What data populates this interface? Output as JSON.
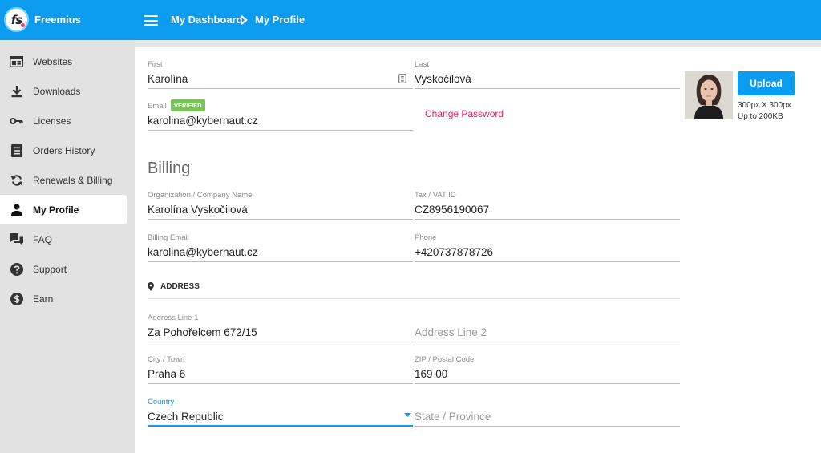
{
  "app": {
    "brand": "Freemius",
    "logo_text": "fs"
  },
  "breadcrumb": [
    "My Dashboard",
    "My Profile"
  ],
  "sidebar": {
    "items": [
      {
        "label": "Websites",
        "icon": "browser-window-icon"
      },
      {
        "label": "Downloads",
        "icon": "download-icon"
      },
      {
        "label": "Licenses",
        "icon": "key-icon"
      },
      {
        "label": "Orders History",
        "icon": "list-document-icon"
      },
      {
        "label": "Renewals & Billing",
        "icon": "sync-icon"
      },
      {
        "label": "My Profile",
        "icon": "person-icon",
        "active": true
      },
      {
        "label": "FAQ",
        "icon": "chat-bubbles-icon"
      },
      {
        "label": "Support",
        "icon": "question-circle-icon"
      },
      {
        "label": "Earn",
        "icon": "dollar-circle-icon"
      }
    ]
  },
  "profile": {
    "first": {
      "label": "First",
      "value": "Karolína"
    },
    "last": {
      "label": "Last",
      "value": "Vyskočilová"
    },
    "email": {
      "label": "Email",
      "badge": "VERIFIED",
      "value": "karolina@kybernaut.cz"
    },
    "change_password": "Change Password",
    "upload_label": "Upload",
    "upload_dims": "300px X 300px",
    "upload_size": "Up to 200KB"
  },
  "billing": {
    "heading": "Billing",
    "company": {
      "label": "Organization / Company Name",
      "value": "Karolína Vyskočilová"
    },
    "tax": {
      "label": "Tax / VAT ID",
      "value": "CZ8956190067"
    },
    "billing_email": {
      "label": "Billing Email",
      "value": "karolina@kybernaut.cz"
    },
    "phone": {
      "label": "Phone",
      "value": "+420737878726"
    }
  },
  "address": {
    "heading": "ADDRESS",
    "line1": {
      "label": "Address Line 1",
      "value": "Za Pohořelcem 672/15"
    },
    "line2": {
      "placeholder": "Address Line 2"
    },
    "city": {
      "label": "City / Town",
      "value": "Praha 6"
    },
    "zip": {
      "label": "ZIP / Postal Code",
      "value": "169 00"
    },
    "country": {
      "label": "Country",
      "value": "Czech Republic"
    },
    "state": {
      "placeholder": "State / Province"
    }
  },
  "colors": {
    "primary": "#0b9cf0",
    "accent": "#e91e63",
    "verified": "#7cc25a"
  }
}
